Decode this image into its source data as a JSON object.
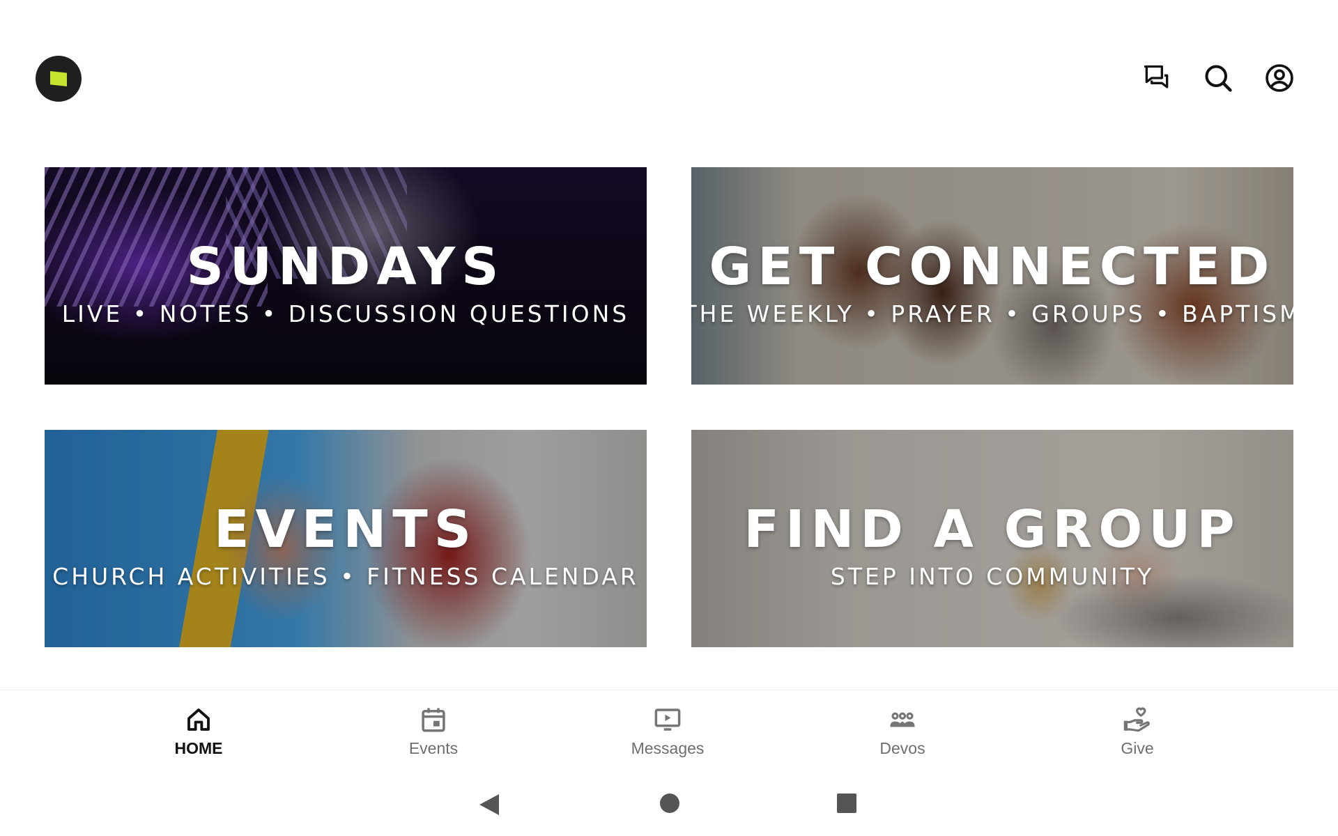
{
  "app": {
    "logo_icon": "church-logo-icon",
    "brand_color": "#c6e32f"
  },
  "header": {
    "actions": [
      {
        "name": "messages-chat-button",
        "icon": "chat-bubbles-icon"
      },
      {
        "name": "search-button",
        "icon": "search-icon"
      },
      {
        "name": "profile-button",
        "icon": "account-circle-icon"
      }
    ]
  },
  "tiles": [
    {
      "title": "SUNDAYS",
      "subtitle": "LIVE • NOTES • DISCUSSION QUESTIONS"
    },
    {
      "title": "GET CONNECTED",
      "subtitle": "THE WEEKLY • PRAYER • GROUPS • BAPTISM"
    },
    {
      "title": "EVENTS",
      "subtitle": "CHURCH ACTIVITIES • FITNESS CALENDAR"
    },
    {
      "title": "FIND A GROUP",
      "subtitle": "STEP INTO COMMUNITY"
    }
  ],
  "bottom_nav": {
    "items": [
      {
        "label": "HOME",
        "icon": "home-icon",
        "active": true
      },
      {
        "label": "Events",
        "icon": "calendar-icon",
        "active": false
      },
      {
        "label": "Messages",
        "icon": "video-player-icon",
        "active": false
      },
      {
        "label": "Devos",
        "icon": "group-people-icon",
        "active": false
      },
      {
        "label": "Give",
        "icon": "heart-hand-icon",
        "active": false
      }
    ]
  },
  "system_nav": {
    "back": "back-triangle-icon",
    "home": "home-circle-icon",
    "recents": "recents-square-icon"
  }
}
